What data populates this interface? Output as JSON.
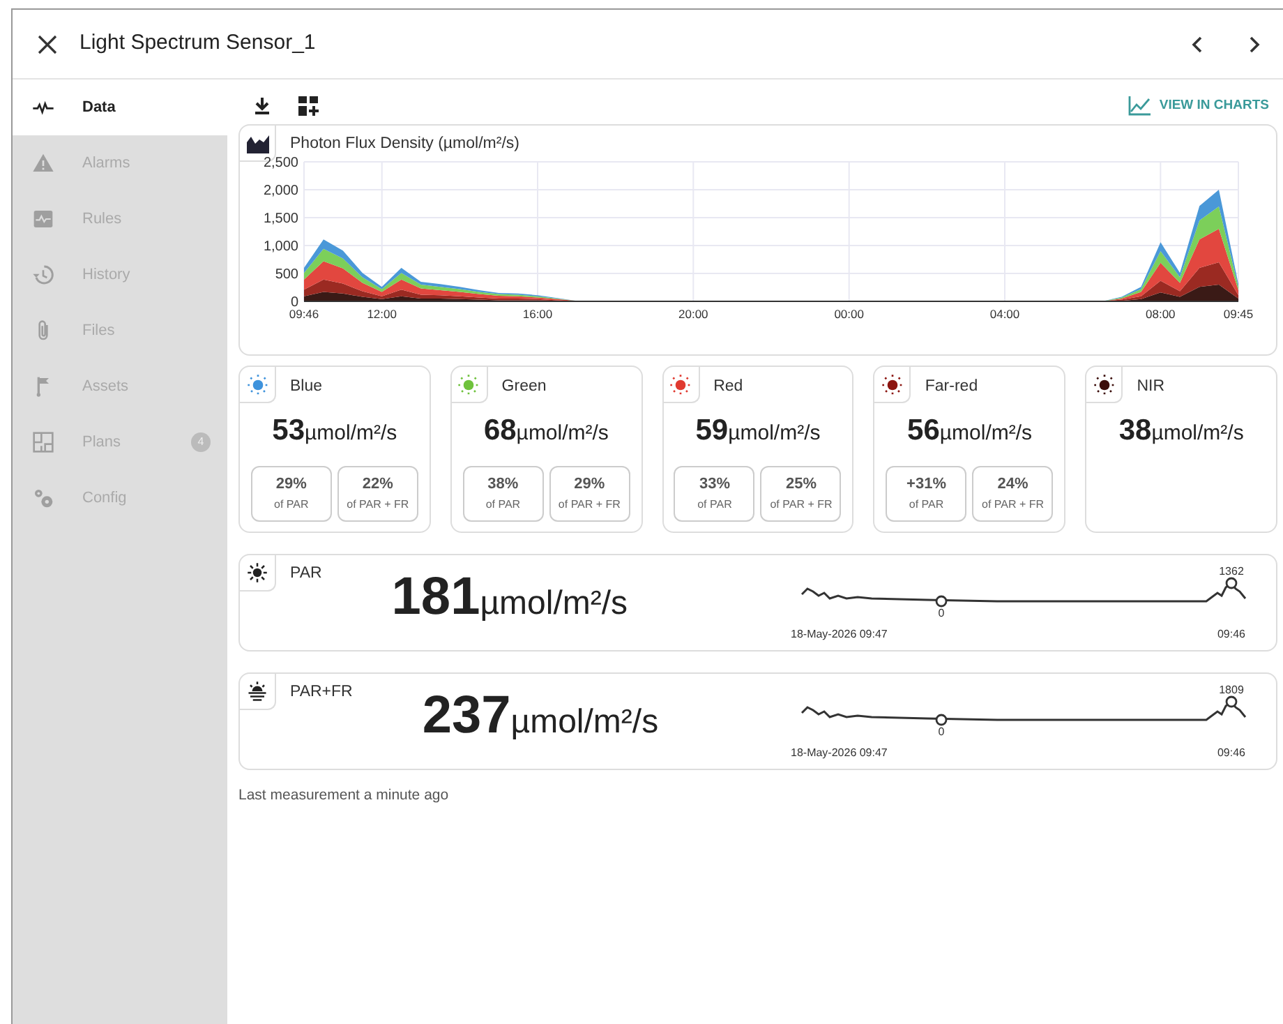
{
  "window": {
    "title": "Light Spectrum Sensor_1"
  },
  "sidebar": {
    "items": [
      {
        "label": "Data",
        "selected": true,
        "disabled": false
      },
      {
        "label": "Alarms",
        "selected": false,
        "disabled": true
      },
      {
        "label": "Rules",
        "selected": false,
        "disabled": true
      },
      {
        "label": "History",
        "selected": false,
        "disabled": true
      },
      {
        "label": "Files",
        "selected": false,
        "disabled": true
      },
      {
        "label": "Assets",
        "selected": false,
        "disabled": true
      },
      {
        "label": "Plans",
        "selected": false,
        "disabled": true,
        "badge": "4"
      },
      {
        "label": "Config",
        "selected": false,
        "disabled": true
      }
    ]
  },
  "toolbar": {
    "view_in_charts": "VIEW IN CHARTS"
  },
  "chart_card": {
    "title": "Photon Flux Density (µmol/m²/s)",
    "chart_data": {
      "type": "area",
      "stacked": true,
      "grid": true,
      "ylim": [
        0,
        2500
      ],
      "categories": [
        "09:46",
        null,
        null,
        null,
        "12:00",
        null,
        null,
        null,
        null,
        null,
        null,
        null,
        "16:00",
        null,
        null,
        null,
        null,
        null,
        null,
        null,
        "20:00",
        null,
        null,
        null,
        null,
        null,
        null,
        null,
        "00:00",
        null,
        null,
        null,
        null,
        null,
        null,
        null,
        "04:00",
        null,
        null,
        null,
        null,
        null,
        null,
        null,
        "08:00",
        null,
        null,
        null,
        "09:45"
      ],
      "series": [
        {
          "color": "#3a1a16",
          "values": [
            90,
            170,
            140,
            80,
            40,
            90,
            50,
            50,
            40,
            30,
            20,
            20,
            20,
            10,
            0,
            0,
            0,
            0,
            0,
            0,
            0,
            0,
            0,
            0,
            0,
            0,
            0,
            0,
            0,
            0,
            0,
            0,
            0,
            0,
            0,
            0,
            0,
            0,
            0,
            0,
            0,
            0,
            10,
            40,
            160,
            80,
            260,
            300,
            50
          ]
        },
        {
          "color": "#9b2a22",
          "values": [
            120,
            220,
            180,
            100,
            50,
            120,
            70,
            60,
            50,
            40,
            30,
            30,
            20,
            10,
            0,
            0,
            0,
            0,
            0,
            0,
            0,
            0,
            0,
            0,
            0,
            0,
            0,
            0,
            0,
            0,
            0,
            0,
            0,
            0,
            0,
            0,
            0,
            0,
            0,
            0,
            0,
            0,
            20,
            50,
            210,
            100,
            340,
            400,
            60
          ]
        },
        {
          "color": "#e2473f",
          "values": [
            180,
            330,
            270,
            150,
            80,
            180,
            110,
            90,
            80,
            60,
            50,
            40,
            30,
            20,
            10,
            0,
            0,
            0,
            0,
            0,
            0,
            0,
            0,
            0,
            0,
            0,
            0,
            0,
            0,
            0,
            0,
            0,
            0,
            0,
            0,
            0,
            0,
            0,
            0,
            0,
            0,
            0,
            20,
            80,
            320,
            150,
            510,
            600,
            90
          ]
        },
        {
          "color": "#7ccf5a",
          "values": [
            120,
            220,
            180,
            100,
            50,
            120,
            70,
            60,
            50,
            40,
            30,
            30,
            20,
            10,
            0,
            0,
            0,
            0,
            0,
            0,
            0,
            0,
            0,
            0,
            0,
            0,
            0,
            0,
            0,
            0,
            0,
            0,
            0,
            0,
            0,
            0,
            0,
            0,
            0,
            0,
            0,
            0,
            20,
            50,
            210,
            100,
            340,
            400,
            60
          ]
        },
        {
          "color": "#4a98d8",
          "values": [
            90,
            170,
            140,
            80,
            40,
            90,
            50,
            50,
            40,
            30,
            20,
            20,
            20,
            10,
            0,
            0,
            0,
            0,
            0,
            0,
            0,
            0,
            0,
            0,
            0,
            0,
            0,
            0,
            0,
            0,
            0,
            0,
            0,
            0,
            0,
            0,
            0,
            0,
            0,
            0,
            0,
            0,
            10,
            40,
            160,
            80,
            260,
            300,
            50
          ]
        }
      ],
      "yticks": [
        {
          "value": 0,
          "label": "0"
        },
        {
          "value": 500,
          "label": "500"
        },
        {
          "value": 1000,
          "label": "1,000"
        },
        {
          "value": 1500,
          "label": "1,500"
        },
        {
          "value": 2000,
          "label": "2,000"
        },
        {
          "value": 2500,
          "label": "2,500"
        }
      ]
    }
  },
  "channels": [
    {
      "name": "Blue",
      "color": "#3f93dc",
      "value": "53",
      "unit": "µmol/m²/s",
      "shares": [
        {
          "value": "29%",
          "label": "of PAR"
        },
        {
          "value": "22%",
          "label": "of PAR + FR"
        }
      ]
    },
    {
      "name": "Green",
      "color": "#6fc23d",
      "value": "68",
      "unit": "µmol/m²/s",
      "shares": [
        {
          "value": "38%",
          "label": "of PAR"
        },
        {
          "value": "29%",
          "label": "of PAR + FR"
        }
      ]
    },
    {
      "name": "Red",
      "color": "#e03a30",
      "value": "59",
      "unit": "µmol/m²/s",
      "shares": [
        {
          "value": "33%",
          "label": "of PAR"
        },
        {
          "value": "25%",
          "label": "of PAR + FR"
        }
      ]
    },
    {
      "name": "Far-red",
      "color": "#8b1510",
      "value": "56",
      "unit": "µmol/m²/s",
      "shares": [
        {
          "value": "+31%",
          "label": "of PAR"
        },
        {
          "value": "24%",
          "label": "of PAR + FR"
        }
      ]
    },
    {
      "name": "NIR",
      "color": "#3b0d0a",
      "value": "38",
      "unit": "µmol/m²/s"
    }
  ],
  "totals": [
    {
      "name": "PAR",
      "value": "181",
      "unit": "µmol/m²/s",
      "max_label": "1362",
      "min_label": "0",
      "start": "18-May-2026 09:47",
      "end": "09:46"
    },
    {
      "name": "PAR+FR",
      "value": "237",
      "unit": "µmol/m²/s",
      "max_label": "1809",
      "min_label": "0",
      "start": "18-May-2026 09:47",
      "end": "09:46"
    }
  ],
  "footer": "Last measurement a minute ago"
}
